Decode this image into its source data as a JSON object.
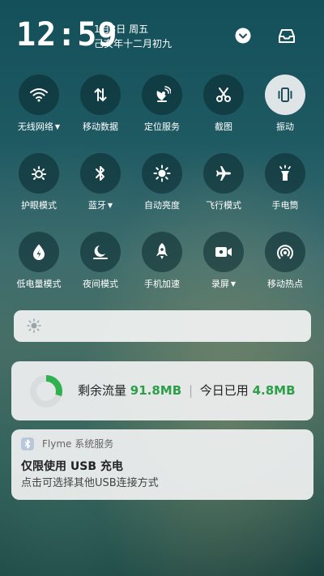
{
  "status": {
    "time": "12:59",
    "date": "1月3日 周五",
    "lunar": "己亥年十二月初九"
  },
  "header": {
    "expand_icon": "chevron-down-circle-icon",
    "inbox_icon": "inbox-tray-icon"
  },
  "toggles": [
    {
      "label": "无线网络",
      "icon": "wifi-icon",
      "dropdown": true,
      "active": false
    },
    {
      "label": "移动数据",
      "icon": "data-arrows-icon",
      "dropdown": false,
      "active": false
    },
    {
      "label": "定位服务",
      "icon": "location-satellite-icon",
      "dropdown": false,
      "active": false
    },
    {
      "label": "截图",
      "icon": "scissors-icon",
      "dropdown": false,
      "active": false
    },
    {
      "label": "振动",
      "icon": "vibrate-icon",
      "dropdown": false,
      "active": true
    },
    {
      "label": "护眼模式",
      "icon": "eye-care-icon",
      "dropdown": false,
      "active": false
    },
    {
      "label": "蓝牙",
      "icon": "bluetooth-icon",
      "dropdown": true,
      "active": false
    },
    {
      "label": "自动亮度",
      "icon": "auto-brightness-icon",
      "dropdown": false,
      "active": false
    },
    {
      "label": "飞行模式",
      "icon": "airplane-icon",
      "dropdown": false,
      "active": false
    },
    {
      "label": "手电筒",
      "icon": "flashlight-icon",
      "dropdown": false,
      "active": false
    },
    {
      "label": "低电量模式",
      "icon": "battery-saver-icon",
      "dropdown": false,
      "active": false
    },
    {
      "label": "夜间模式",
      "icon": "night-mode-icon",
      "dropdown": false,
      "active": false
    },
    {
      "label": "手机加速",
      "icon": "rocket-icon",
      "dropdown": false,
      "active": false
    },
    {
      "label": "录屏",
      "icon": "screen-record-icon",
      "dropdown": true,
      "active": false
    },
    {
      "label": "移动热点",
      "icon": "hotspot-icon",
      "dropdown": false,
      "active": false
    }
  ],
  "brightness": {
    "icon": "brightness-sun-icon",
    "level": 0
  },
  "traffic": {
    "remaining_label": "剩余流量",
    "remaining_value": "91.8MB",
    "separator": "|",
    "today_label": "今日已用",
    "today_value": "4.8MB",
    "ring_fraction": 0.3,
    "ring_color": "#2fb14f"
  },
  "notification": {
    "app_name": "Flyme 系统服务",
    "app_icon": "bluetooth-small-icon",
    "title": "仅限使用 USB 充电",
    "body": "点击可选择其他USB连接方式"
  }
}
